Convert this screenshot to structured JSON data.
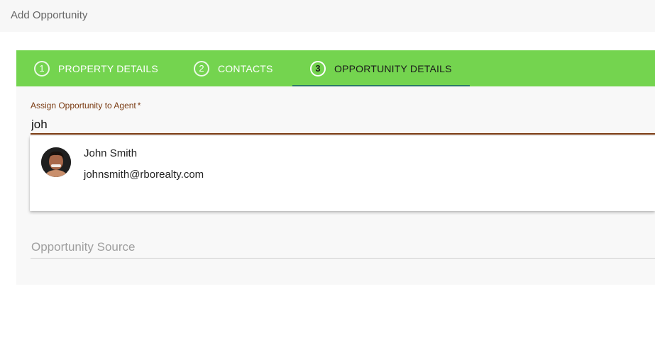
{
  "header": {
    "title": "Add Opportunity"
  },
  "stepper": {
    "steps": [
      {
        "number": "1",
        "label": "PROPERTY DETAILS"
      },
      {
        "number": "2",
        "label": "CONTACTS"
      },
      {
        "number": "3",
        "label": "OPPORTUNITY DETAILS"
      }
    ],
    "active_index": 2
  },
  "form": {
    "agent": {
      "label": "Assign Opportunity to Agent",
      "required_mark": "*",
      "value": "joh"
    },
    "suggestions": [
      {
        "name": "John Smith",
        "email": "johnsmith@rborealty.com",
        "icon": "avatar-photo"
      }
    ],
    "source": {
      "placeholder": "Opportunity Source"
    }
  },
  "colors": {
    "stepper_bg": "#74d44f",
    "active_underline": "#2b7a66",
    "focus_underline": "#7a3b12"
  }
}
